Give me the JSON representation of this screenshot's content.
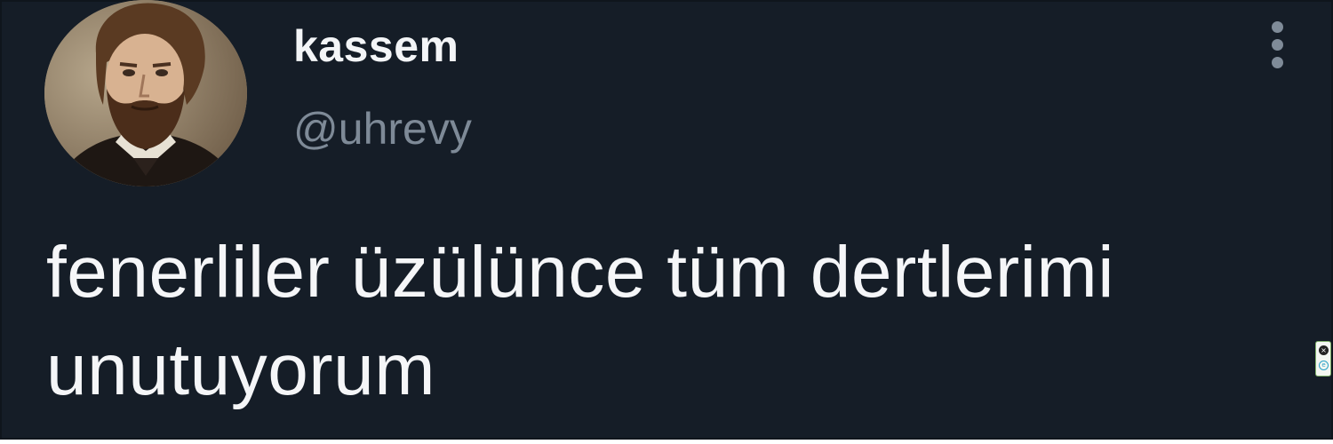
{
  "user": {
    "display_name": "kassem",
    "handle": "@uhrevy",
    "avatar_icon": "bearded-man-portrait"
  },
  "tweet": {
    "text": "fenerliler üzülünce tüm dertlerimi unutuyorum"
  },
  "menu": {
    "icon": "more-vertical-icon"
  },
  "colors": {
    "background": "#151d27",
    "text_primary": "#f5f6f8",
    "text_secondary": "#7e8a97"
  }
}
